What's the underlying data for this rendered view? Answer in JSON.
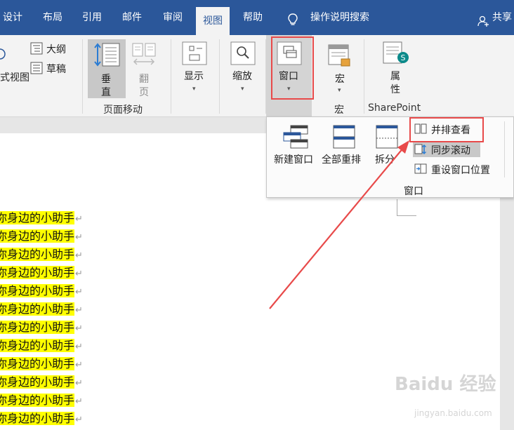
{
  "tabs": [
    "设计",
    "布局",
    "引用",
    "邮件",
    "审阅",
    "视图",
    "帮助"
  ],
  "search_label": "操作说明搜索",
  "share_label": "共享",
  "ribbon": {
    "outline_label": "大纲",
    "draft_label": "草稿",
    "web_view_label": "式视图",
    "vertical_label": "垂\n直",
    "flip_label": "翻\n页",
    "page_move_group": "页面移动",
    "show_label": "显示",
    "zoom_label": "缩放",
    "window_label": "窗口",
    "macro_label": "宏",
    "macro_group": "宏",
    "properties_label": "属\n性",
    "sharepoint_group": "SharePoint"
  },
  "dropdown": {
    "new_window": "新建窗口",
    "arrange_all": "全部重排",
    "split": "拆分",
    "side_by_side": "并排查看",
    "sync_scroll": "同步滚动",
    "reset_position": "重设窗口位置",
    "group_label": "窗口"
  },
  "document": {
    "line_text": "你身边的小助手",
    "line_count": 12,
    "paragraph_mark": "↵"
  },
  "watermark": {
    "brand": "Baidu 经验",
    "url": "jingyan.baidu.com"
  },
  "colors": {
    "accent": "#2b579a",
    "highlight": "#ffff00",
    "callout": "#e84a4a"
  }
}
